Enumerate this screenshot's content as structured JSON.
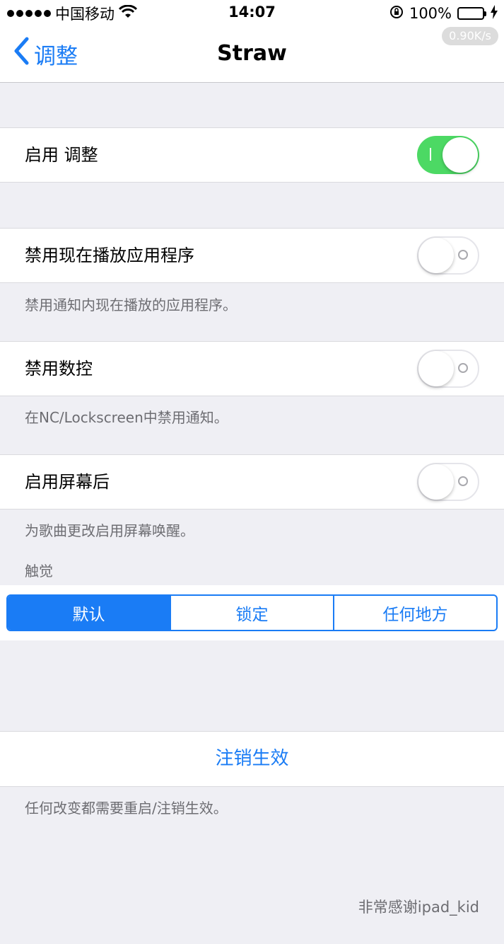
{
  "status_bar": {
    "carrier": "中国移动",
    "time": "14:07",
    "battery": "100%",
    "network_speed": "0.90K/s"
  },
  "nav": {
    "back_label": "调整",
    "title": "Straw"
  },
  "rows": {
    "enable": {
      "label": "启用 调整",
      "on": true
    },
    "disable_now_playing": {
      "label": "禁用现在播放应用程序",
      "on": false,
      "footer": "禁用通知内现在播放的应用程序。"
    },
    "disable_nc": {
      "label": "禁用数控",
      "on": false,
      "footer": "在NC/Lockscreen中禁用通知。"
    },
    "enable_screen": {
      "label": "启用屏幕后",
      "on": false,
      "footer": "为歌曲更改启用屏幕唤醒。"
    }
  },
  "haptics": {
    "header": "触觉",
    "segments": [
      "默认",
      "锁定",
      "任何地方"
    ],
    "selected": "默认"
  },
  "respring": {
    "label": "注销生效",
    "footer": "任何改变都需要重启/注销生效。"
  },
  "credit": "非常感谢ipad_kid",
  "colors": {
    "accent": "#1a7cf5",
    "toggle_on": "#4cd964",
    "background": "#efeff4"
  },
  "icons": [
    "signal-dots-icon",
    "wifi-icon",
    "rotation-lock-icon",
    "battery-icon",
    "charging-bolt-icon",
    "chevron-left-icon"
  ]
}
